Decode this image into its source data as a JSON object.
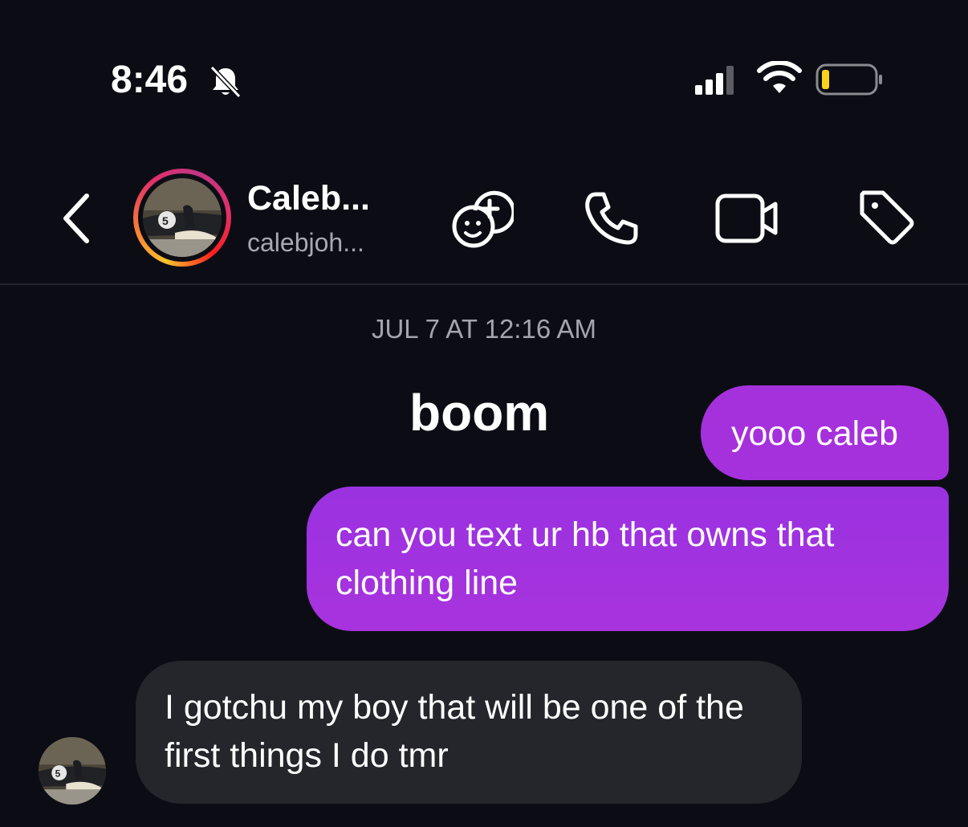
{
  "status_bar": {
    "time": "8:46",
    "icons": [
      "bell-slash-icon",
      "cellular-signal-icon",
      "wifi-icon",
      "battery-icon"
    ],
    "battery_color": "#f7d11e"
  },
  "header": {
    "name": "Caleb...",
    "username": "calebjoh...",
    "icons": [
      "back-chevron-icon",
      "effects-icon",
      "phone-icon",
      "video-camera-icon",
      "tag-icon"
    ]
  },
  "conversation": {
    "timestamp": "JUL 7 AT 12:16 AM",
    "messages": [
      {
        "direction": "outgoing",
        "text": "boom",
        "type": "large-text"
      },
      {
        "direction": "outgoing",
        "text": "yooo caleb"
      },
      {
        "direction": "outgoing",
        "text": "can you text ur hb that owns that clothing line"
      },
      {
        "direction": "incoming",
        "text": "I gotchu my boy that will be one of the first things I do tmr"
      }
    ]
  },
  "colors": {
    "background": "#0c0d14",
    "outgoing_bubble": "#a531dc",
    "incoming_bubble": "#25262c",
    "secondary_text": "#a8a9b0"
  }
}
